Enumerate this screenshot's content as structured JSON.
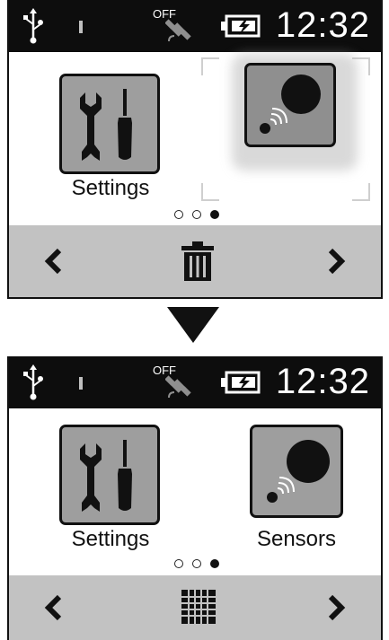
{
  "top_screen": {
    "status": {
      "gps_off_label": "OFF",
      "clock": "12:32"
    },
    "apps": [
      {
        "label": "Settings",
        "icon": "settings-icon"
      },
      {
        "label": "",
        "icon": "sensors-icon",
        "state": "dragging"
      }
    ],
    "page_indicator": {
      "pages": 3,
      "current": 3
    },
    "nav": {
      "prev_icon": "chevron-left-icon",
      "center_icon": "trash-icon",
      "next_icon": "chevron-right-icon"
    }
  },
  "transition": {
    "icon": "arrow-down-icon"
  },
  "bottom_screen": {
    "status": {
      "gps_off_label": "OFF",
      "clock": "12:32"
    },
    "apps": [
      {
        "label": "Settings",
        "icon": "settings-icon"
      },
      {
        "label": "Sensors",
        "icon": "sensors-icon"
      }
    ],
    "page_indicator": {
      "pages": 3,
      "current": 3
    },
    "nav": {
      "prev_icon": "chevron-left-icon",
      "center_icon": "grid-icon",
      "next_icon": "chevron-right-icon"
    }
  },
  "colors": {
    "statusbar": "#0d0d0d",
    "navbar": "#c2c2c2",
    "tile": "#9e9e9e",
    "tile_border": "#111111"
  }
}
